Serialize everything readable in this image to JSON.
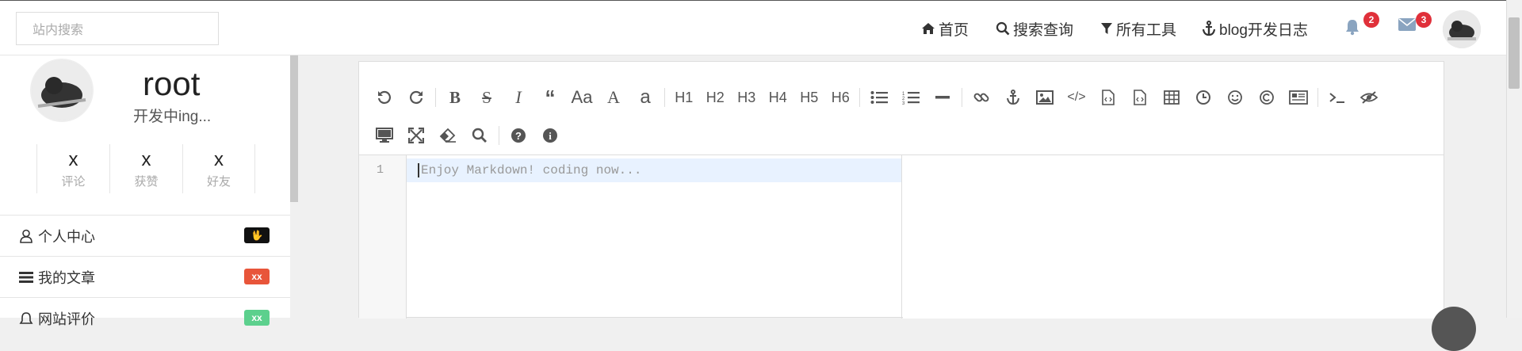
{
  "header": {
    "search_placeholder": "站内搜索",
    "nav": [
      {
        "label": "首页",
        "icon": "home-icon"
      },
      {
        "label": "搜索查询",
        "icon": "search-icon"
      },
      {
        "label": "所有工具",
        "icon": "filter-icon"
      },
      {
        "label": "blog开发日志",
        "icon": "anchor-icon"
      }
    ],
    "notifications_count": "2",
    "messages_count": "3"
  },
  "profile": {
    "username": "root",
    "motto": "开发中ing...",
    "stats": [
      {
        "value": "x",
        "label": "评论"
      },
      {
        "value": "x",
        "label": "获赞"
      },
      {
        "value": "x",
        "label": "好友"
      }
    ]
  },
  "sidebar": {
    "items": [
      {
        "label": "个人中心",
        "badge": "🖖",
        "badge_color": "#111111",
        "icon": "user-icon"
      },
      {
        "label": "我的文章",
        "badge": "xx",
        "badge_color": "#e8553a",
        "icon": "list-icon"
      },
      {
        "label": "网站评价",
        "badge": "xx",
        "badge_color": "#5cd08d",
        "icon": "bell-icon"
      }
    ]
  },
  "editor": {
    "toolbar_row1": [
      "undo",
      "redo",
      "bold",
      "strikethrough",
      "italic",
      "quote",
      "Aa",
      "A",
      "a",
      "H1",
      "H2",
      "H3",
      "H4",
      "H5",
      "H6",
      "ul",
      "ol",
      "hr",
      "link",
      "anchor",
      "image",
      "code",
      "code-block",
      "pre",
      "table",
      "datetime",
      "emoji",
      "html-entities",
      "pagebreak",
      "terminal",
      "preview-off"
    ],
    "toolbar_row2": [
      "desktop",
      "fullscreen",
      "eraser",
      "search",
      "help",
      "info"
    ],
    "line_number": "1",
    "placeholder": "Enjoy Markdown! coding now..."
  },
  "colors": {
    "badge_red": "#e0303a"
  }
}
